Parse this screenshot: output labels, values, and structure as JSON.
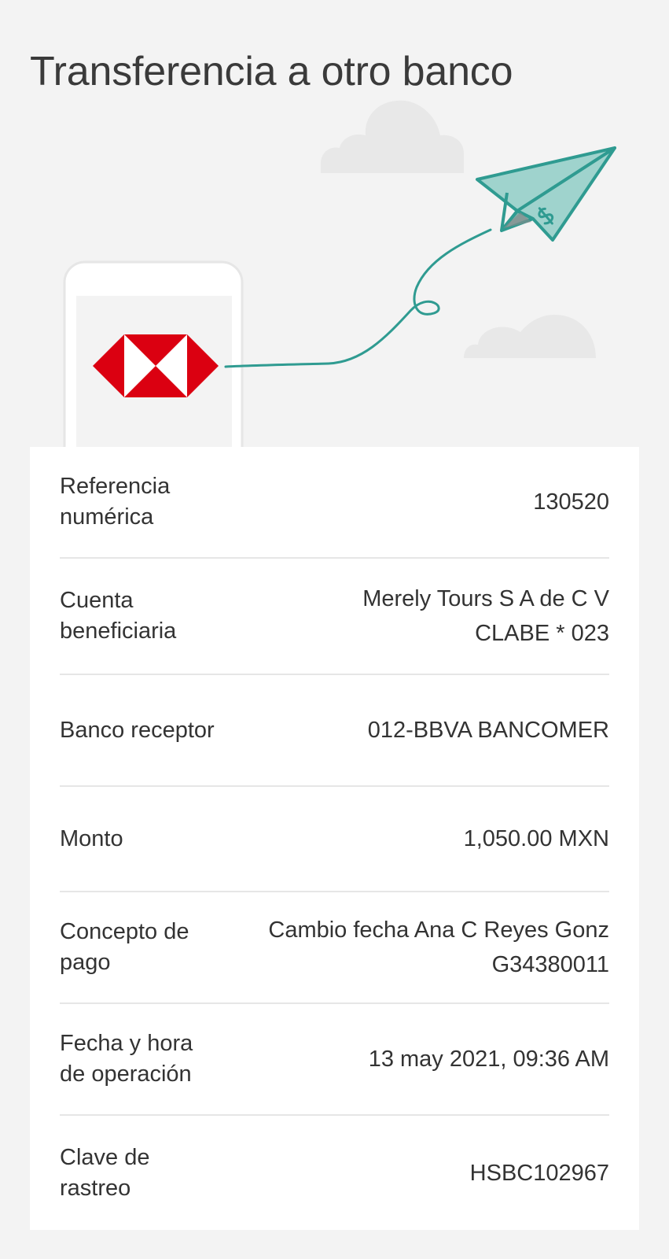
{
  "header": {
    "title": "Transferencia a otro banco"
  },
  "illustration": {
    "icons": [
      "cloud-icon",
      "phone-icon",
      "hsbc-logo-icon",
      "paper-plane-icon",
      "dollar-icon"
    ],
    "colors": {
      "plane_stroke": "#2f9b91",
      "plane_fill": "#9fd3cd",
      "cloud": "#e6e6e6",
      "logo_red": "#db0011",
      "phone_frame": "#e9e9e9"
    }
  },
  "details": [
    {
      "label": "Referencia numérica",
      "value_lines": [
        "130520"
      ]
    },
    {
      "label": "Cuenta beneficiaria",
      "value_lines": [
        "Merely Tours S A de C V",
        "CLABE * 023"
      ]
    },
    {
      "label": "Banco receptor",
      "value_lines": [
        "012-BBVA BANCOMER"
      ]
    },
    {
      "label": "Monto",
      "value_lines": [
        "1,050.00 MXN"
      ]
    },
    {
      "label": "Concepto de pago",
      "value_lines": [
        "Cambio fecha Ana C Reyes Gonz",
        "G34380011"
      ]
    },
    {
      "label": "Fecha y hora de operación",
      "value_lines": [
        "13 may 2021, 09:36 AM"
      ]
    },
    {
      "label": "Clave de rastreo",
      "value_lines": [
        "HSBC102967"
      ]
    }
  ]
}
